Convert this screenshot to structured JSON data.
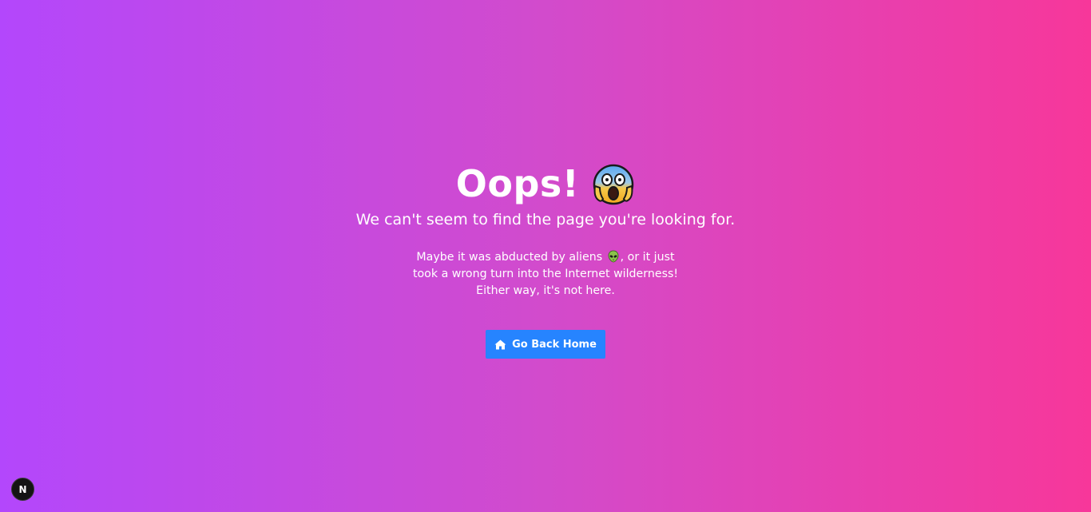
{
  "heading": {
    "title": "Oops!",
    "title_emoji": "face-screaming-in-fear-icon"
  },
  "subtitle": "We can't seem to find the page you're looking for.",
  "description": {
    "before_emoji": "Maybe it was abducted by aliens",
    "emoji": "alien-icon",
    "after_emoji": ", or it just took a wrong turn into the Internet wilderness! Either way, it's not here."
  },
  "home_button": {
    "label": "Go Back Home",
    "icon": "home-icon",
    "color": "#2684ff"
  },
  "dev_badge": {
    "label": "N"
  },
  "colors": {
    "gradient_start": "#b347fc",
    "gradient_end": "#f7379a"
  }
}
